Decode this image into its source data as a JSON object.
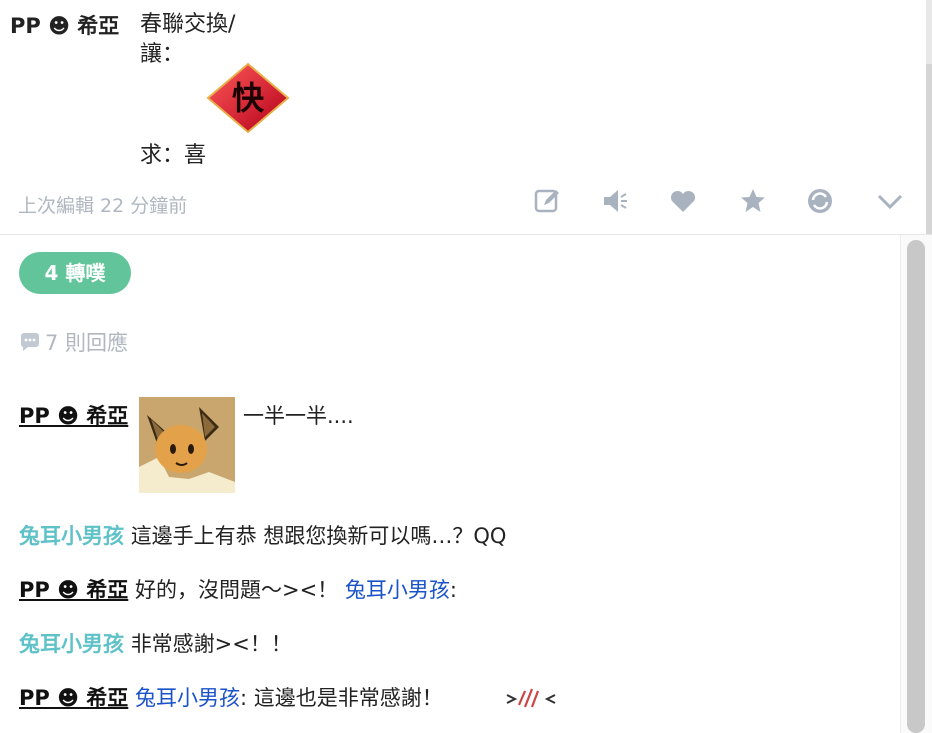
{
  "post": {
    "poster_name": "PP ☻ 希亞",
    "line1": "春聯交換/",
    "line2": "讓：",
    "kuai_char": "快",
    "line3": "求：喜",
    "edited": "上次編輯 22 分鐘前",
    "actions": [
      "edit-icon",
      "mute-icon",
      "heart-icon",
      "star-icon",
      "replurk-icon",
      "chevron-down-icon"
    ]
  },
  "responses_header": {
    "replurk_badge": "4 轉噗",
    "count_label": "7 則回應"
  },
  "responses": [
    {
      "user": "PP ☻ 希亞",
      "text": "一半一半...."
    },
    {
      "user": "兔耳小男孩",
      "text": "這邊手上有恭 想跟您換新可以嗎…？QQ"
    },
    {
      "user": "PP ☻ 希亞",
      "text": "好的，沒問題～><！",
      "mention": "兔耳小男孩",
      "after_mention": ":"
    },
    {
      "user": "兔耳小男孩",
      "text": "非常感謝><！！"
    },
    {
      "user": "PP ☻ 希亞",
      "mention": "兔耳小男孩",
      "after_mention": ": 這邊也是非常感謝！"
    }
  ],
  "colors": {
    "accent_green": "#61c49a",
    "cyan_user": "#5fc2c9",
    "mention_blue": "#1a53c8",
    "muted_gray": "#b0b7c0"
  }
}
